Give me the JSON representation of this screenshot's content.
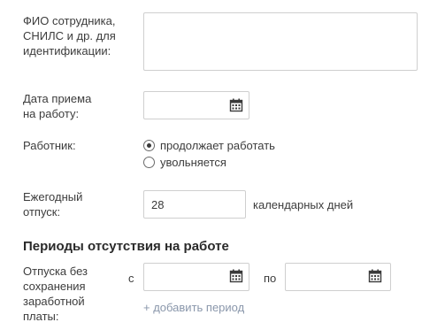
{
  "employee_id": {
    "label_lines": [
      "ФИО сотрудника,",
      "СНИЛС и др. для",
      "идентификации:"
    ],
    "value": ""
  },
  "hire_date": {
    "label_lines": [
      "Дата приема",
      "на работу:"
    ],
    "value": "",
    "icon": "calendar-icon"
  },
  "worker_status": {
    "label": "Работник:",
    "options": [
      {
        "label": "продолжает работать",
        "selected": true
      },
      {
        "label": "увольняется",
        "selected": false
      }
    ]
  },
  "annual_leave": {
    "label_lines": [
      "Ежегодный",
      "отпуск:"
    ],
    "value": "28",
    "unit": "календарных дней"
  },
  "absence_section": {
    "title": "Периоды отсутствия на работе",
    "unpaid_leave": {
      "label_lines": [
        "Отпуска без",
        "сохранения",
        "заработной",
        "платы:"
      ],
      "from_label": "с",
      "to_label": "по",
      "from_value": "",
      "to_value": "",
      "add_period_link": "+ добавить период"
    }
  }
}
